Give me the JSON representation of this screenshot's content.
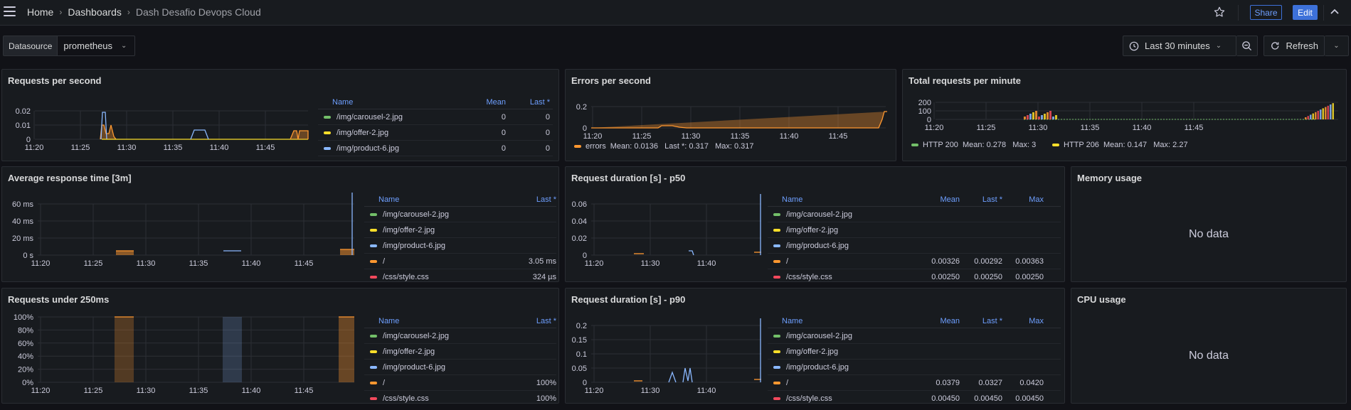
{
  "header": {
    "breadcrumb": [
      "Home",
      "Dashboards",
      "Dash Desafio Devops Cloud"
    ],
    "share_label": "Share",
    "edit_label": "Edit"
  },
  "datasource": {
    "label": "Datasource",
    "value": "prometheus"
  },
  "time": {
    "range": "Last 30 minutes",
    "refresh_label": "Refresh"
  },
  "colors": {
    "green": "#73bf69",
    "yellow": "#fade2a",
    "blue": "#8ab8ff",
    "orange": "#ff9830",
    "red": "#f2495c"
  },
  "panels": {
    "rps": {
      "title": "Requests per second",
      "yticks": [
        "0.02",
        "0.01",
        "0"
      ],
      "xticks": [
        "11:20",
        "11:25",
        "11:30",
        "11:35",
        "11:40",
        "11:45"
      ],
      "legend_headers": [
        "Name",
        "Mean",
        "Last *"
      ],
      "legend": [
        {
          "name": "/img/carousel-2.jpg",
          "mean": "0",
          "last": "0",
          "color": "green"
        },
        {
          "name": "/img/offer-2.jpg",
          "mean": "0",
          "last": "0",
          "color": "yellow"
        },
        {
          "name": "/img/product-6.jpg",
          "mean": "0",
          "last": "0",
          "color": "blue"
        }
      ]
    },
    "eps": {
      "title": "Errors per second",
      "yticks": [
        "0.2",
        "0"
      ],
      "xticks": [
        "11:20",
        "11:25",
        "11:30",
        "11:35",
        "11:40",
        "11:45"
      ],
      "legend": {
        "name": "errors",
        "stats": "Mean: 0.0136   Last *: 0.317   Max: 0.317"
      }
    },
    "trpm": {
      "title": "Total requests per minute",
      "yticks": [
        "200",
        "100",
        "0"
      ],
      "xticks": [
        "11:20",
        "11:25",
        "11:30",
        "11:35",
        "11:40",
        "11:45"
      ],
      "legend": [
        {
          "name": "HTTP 200",
          "stats": "Mean: 0.278   Max: 3",
          "color": "green"
        },
        {
          "name": "HTTP 206",
          "stats": "Mean: 0.147   Max: 2.27",
          "color": "yellow"
        }
      ]
    },
    "art": {
      "title": "Average response time [3m]",
      "yticks": [
        "60 ms",
        "40 ms",
        "20 ms",
        "0 s"
      ],
      "xticks": [
        "11:20",
        "11:25",
        "11:30",
        "11:35",
        "11:40",
        "11:45"
      ],
      "legend_headers": [
        "Name",
        "Last *"
      ],
      "legend": [
        {
          "name": "/img/carousel-2.jpg",
          "last": "",
          "color": "green"
        },
        {
          "name": "/img/offer-2.jpg",
          "last": "",
          "color": "yellow"
        },
        {
          "name": "/img/product-6.jpg",
          "last": "",
          "color": "blue"
        },
        {
          "name": "/",
          "last": "3.05 ms",
          "color": "orange"
        },
        {
          "name": "/css/style.css",
          "last": "324 µs",
          "color": "red"
        }
      ]
    },
    "p50": {
      "title": "Request duration [s] - p50",
      "yticks": [
        "0.06",
        "0.04",
        "0.02",
        "0"
      ],
      "xticks": [
        "11:20",
        "11:30",
        "11:40"
      ],
      "legend_headers": [
        "Name",
        "Mean",
        "Last *",
        "Max"
      ],
      "legend": [
        {
          "name": "/img/carousel-2.jpg",
          "mean": "",
          "last": "",
          "max": "",
          "color": "green"
        },
        {
          "name": "/img/offer-2.jpg",
          "mean": "",
          "last": "",
          "max": "",
          "color": "yellow"
        },
        {
          "name": "/img/product-6.jpg",
          "mean": "",
          "last": "",
          "max": "",
          "color": "blue"
        },
        {
          "name": "/",
          "mean": "0.00326",
          "last": "0.00292",
          "max": "0.00363",
          "color": "orange"
        },
        {
          "name": "/css/style.css",
          "mean": "0.00250",
          "last": "0.00250",
          "max": "0.00250",
          "color": "red"
        }
      ]
    },
    "mem": {
      "title": "Memory usage",
      "nodata": "No data"
    },
    "ru250": {
      "title": "Requests under 250ms",
      "yticks": [
        "100%",
        "80%",
        "60%",
        "40%",
        "20%",
        "0%"
      ],
      "xticks": [
        "11:20",
        "11:25",
        "11:30",
        "11:35",
        "11:40",
        "11:45"
      ],
      "legend_headers": [
        "Name",
        "Last *"
      ],
      "legend": [
        {
          "name": "/img/carousel-2.jpg",
          "last": "",
          "color": "green"
        },
        {
          "name": "/img/offer-2.jpg",
          "last": "",
          "color": "yellow"
        },
        {
          "name": "/img/product-6.jpg",
          "last": "",
          "color": "blue"
        },
        {
          "name": "/",
          "last": "100%",
          "color": "orange"
        },
        {
          "name": "/css/style.css",
          "last": "100%",
          "color": "red"
        }
      ]
    },
    "p90": {
      "title": "Request duration [s] - p90",
      "yticks": [
        "0.2",
        "0.15",
        "0.1",
        "0.05",
        "0"
      ],
      "xticks": [
        "11:20",
        "11:30",
        "11:40"
      ],
      "legend_headers": [
        "Name",
        "Mean",
        "Last *",
        "Max"
      ],
      "legend": [
        {
          "name": "/img/carousel-2.jpg",
          "mean": "",
          "last": "",
          "max": "",
          "color": "green"
        },
        {
          "name": "/img/offer-2.jpg",
          "mean": "",
          "last": "",
          "max": "",
          "color": "yellow"
        },
        {
          "name": "/img/product-6.jpg",
          "mean": "",
          "last": "",
          "max": "",
          "color": "blue"
        },
        {
          "name": "/",
          "mean": "0.0379",
          "last": "0.0327",
          "max": "0.0420",
          "color": "orange"
        },
        {
          "name": "/css/style.css",
          "mean": "0.00450",
          "last": "0.00450",
          "max": "0.00450",
          "color": "red"
        }
      ]
    },
    "cpu": {
      "title": "CPU usage",
      "nodata": "No data"
    }
  }
}
